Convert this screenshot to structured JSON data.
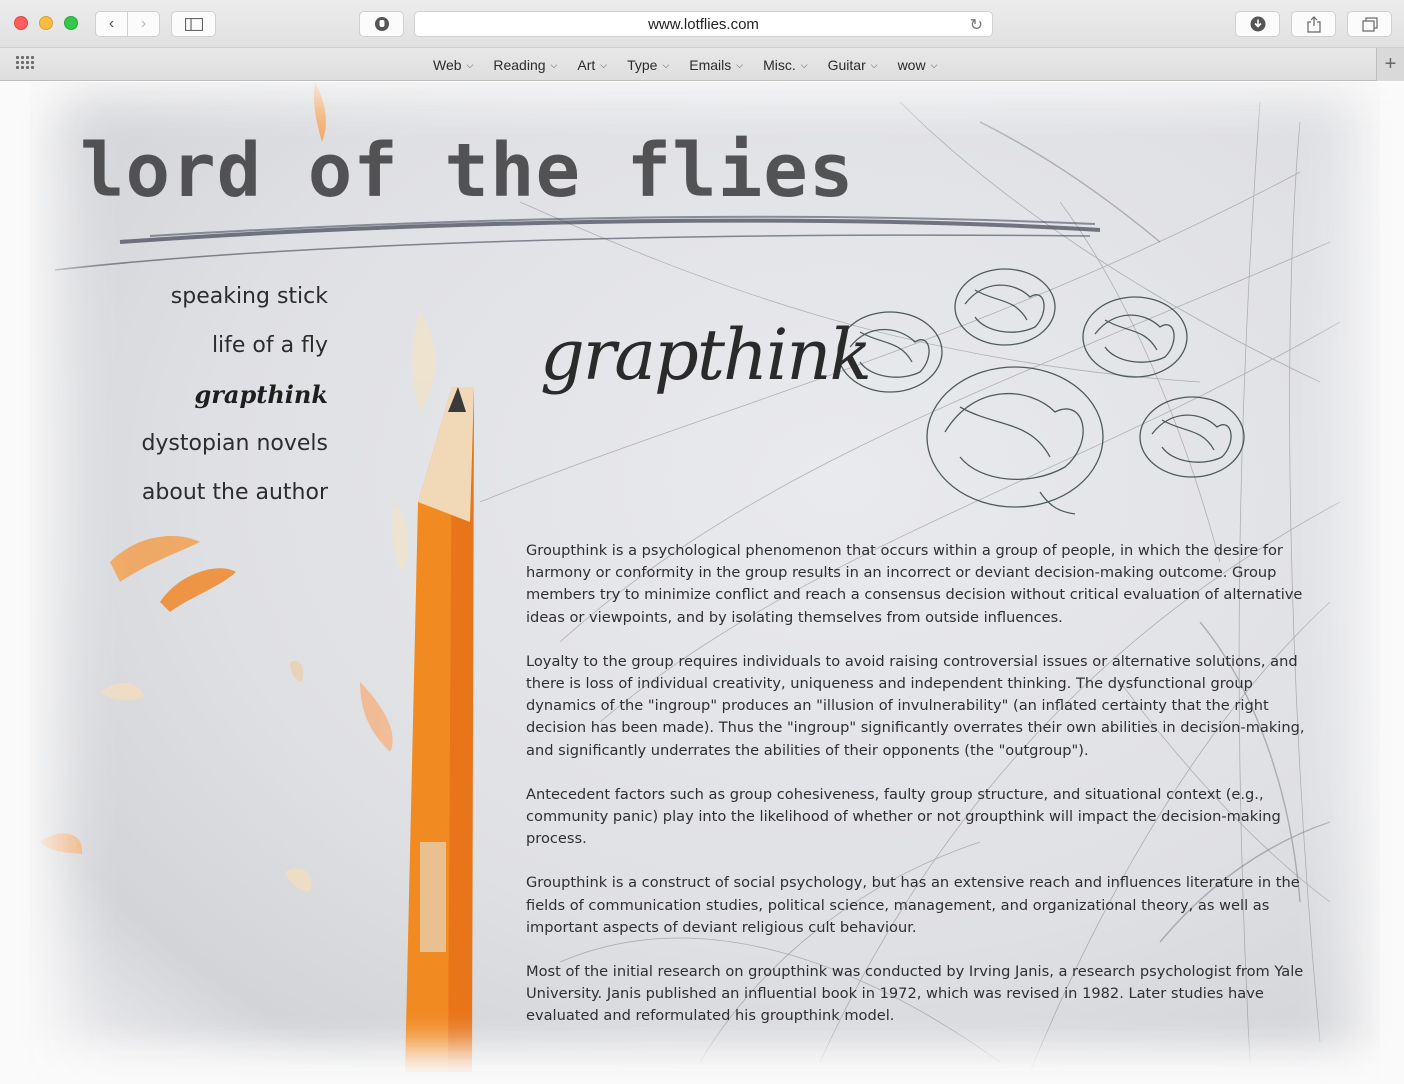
{
  "browser": {
    "url": "www.lotflies.com",
    "bookmarks": [
      "Web",
      "Reading",
      "Art",
      "Type",
      "Emails",
      "Misc.",
      "Guitar",
      "wow"
    ]
  },
  "site": {
    "title": "lord of the flies",
    "nav": [
      {
        "label": "speaking stick",
        "active": false
      },
      {
        "label": "life of a fly",
        "active": false
      },
      {
        "label": "grapthink",
        "active": true
      },
      {
        "label": "dystopian novels",
        "active": false
      },
      {
        "label": "about the author",
        "active": false
      }
    ]
  },
  "article": {
    "heading": "grapthink",
    "paragraphs": [
      "Groupthink is a psychological phenomenon that occurs within a group of people, in which the desire for harmony or conformity in the group results in an incorrect or deviant decision-making outcome. Group members try to minimize conflict and reach a consensus decision without critical evaluation of alternative ideas or viewpoints, and by isolating themselves from outside influences.",
      "Loyalty to the group requires individuals to avoid raising controversial issues or alternative solutions, and there is loss of individual creativity, uniqueness and independent thinking. The dysfunctional group dynamics of the \"ingroup\" produces an \"illusion of invulnerability\" (an inflated certainty that the right decision has been made). Thus the \"ingroup\" significantly overrates their own abilities in decision-making, and significantly underrates the abilities of their opponents (the \"outgroup\").",
      "Antecedent factors such as group cohesiveness, faulty group structure, and situational context (e.g., community panic) play into the likelihood of whether or not groupthink will impact the decision-making process.",
      "Groupthink is a construct of social psychology, but has an extensive reach and influences literature in the fields of communication studies, political science, management, and organizational theory, as well as important aspects of deviant religious cult behaviour.",
      "Most of the initial research on groupthink was conducted by Irving Janis, a research psychologist from Yale University. Janis published an influential book in 1972, which was revised in 1982. Later studies  have evaluated and reformulated his groupthink model."
    ]
  }
}
